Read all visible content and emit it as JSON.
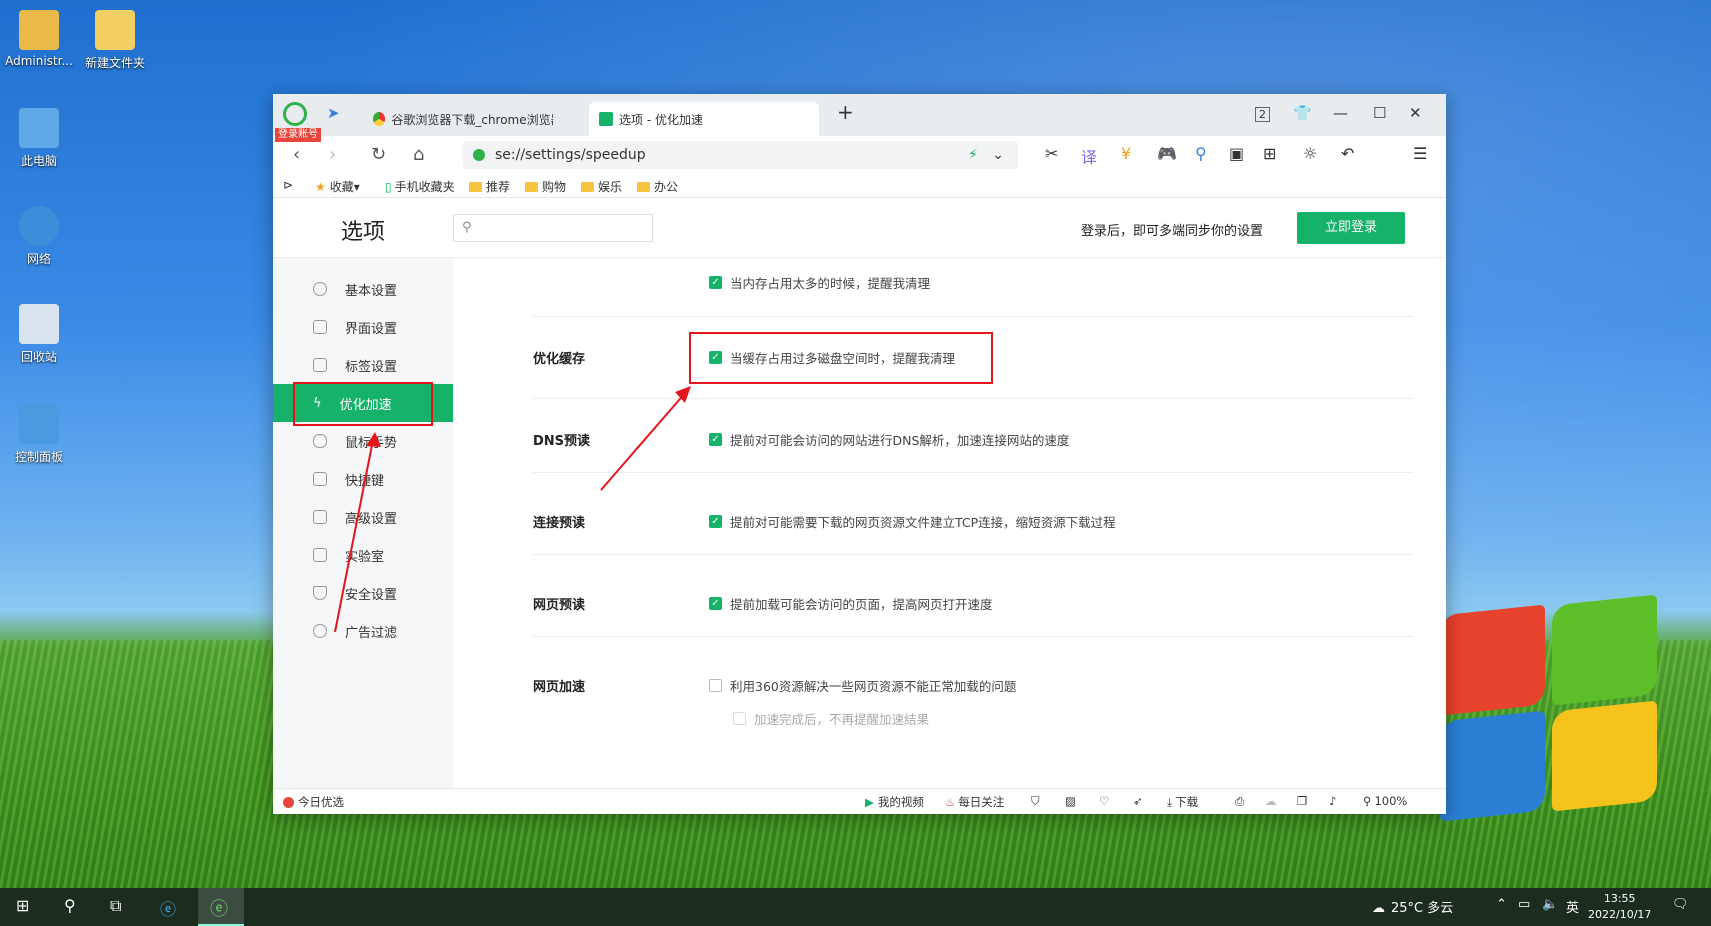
{
  "desktop": {
    "icons": [
      {
        "label": "Administr..."
      },
      {
        "label": "新建文件夹"
      },
      {
        "label": "此电脑"
      },
      {
        "label": "网络"
      },
      {
        "label": "回收站"
      },
      {
        "label": "控制面板"
      }
    ]
  },
  "browser": {
    "login_tag": "登录账号",
    "tabs": [
      {
        "label": "谷歌浏览器下载_chrome浏览器官"
      },
      {
        "label": "选项 - 优化加速"
      }
    ],
    "new_tab": "+",
    "tab_count": "2",
    "address": "se://settings/speedup",
    "bookmarks": [
      "收藏",
      "手机收藏夹",
      "推荐",
      "购物",
      "娱乐",
      "办公"
    ]
  },
  "settings": {
    "title": "选项",
    "search_placeholder": "",
    "login_tip": "登录后，即可多端同步你的设置",
    "login_button": "立即登录",
    "sidebar": [
      {
        "label": "基本设置"
      },
      {
        "label": "界面设置"
      },
      {
        "label": "标签设置"
      },
      {
        "label": "优化加速"
      },
      {
        "label": "鼠标手势"
      },
      {
        "label": "快捷键"
      },
      {
        "label": "高级设置"
      },
      {
        "label": "实验室"
      },
      {
        "label": "安全设置"
      },
      {
        "label": "广告过滤"
      }
    ],
    "sections": {
      "memory_opt": "当内存占用太多的时候，提醒我清理",
      "cache_label": "优化缓存",
      "cache_opt": "当缓存占用过多磁盘空间时，提醒我清理",
      "dns_label": "DNS预读",
      "dns_opt": "提前对可能会访问的网站进行DNS解析，加速连接网站的速度",
      "conn_label": "连接预读",
      "conn_opt": "提前对可能需要下载的网页资源文件建立TCP连接，缩短资源下载过程",
      "page_label": "网页预读",
      "page_opt": "提前加载可能会访问的页面，提高网页打开速度",
      "accel_label": "网页加速",
      "accel_opt": "利用360资源解决一些网页资源不能正常加载的问题",
      "accel_sub": "加速完成后，不再提醒加速结果"
    }
  },
  "statusbar": {
    "today": "今日优选",
    "my_video": "我的视频",
    "daily": "每日关注",
    "download": "下载",
    "zoom": "100%"
  },
  "taskbar": {
    "weather": "25°C 多云",
    "ime": "英",
    "time": "13:55",
    "date": "2022/10/17"
  },
  "colors": {
    "accent": "#17b26a",
    "highlight": "#e5161b"
  }
}
